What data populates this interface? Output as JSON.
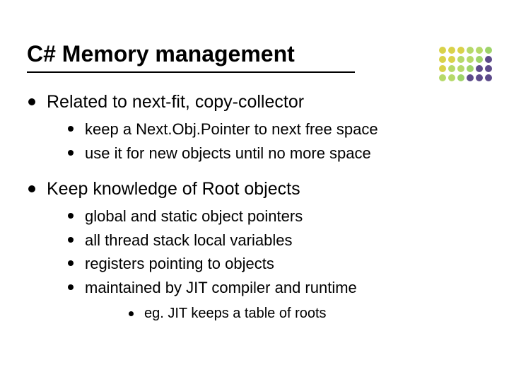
{
  "title": "C# Memory management",
  "bullets": {
    "item1": {
      "text": "Related to next-fit, copy-collector",
      "sub1": "keep a Next.Obj.Pointer to next free space",
      "sub2": "use it for new objects until no more space"
    },
    "item2": {
      "text": "Keep knowledge of Root objects",
      "sub1": "global and static object pointers",
      "sub2": "all thread stack local variables",
      "sub3": "registers pointing to objects",
      "sub4": "maintained by JIT compiler and runtime",
      "sub4a": "eg. JIT keeps a table of roots"
    }
  },
  "decor_colors": [
    "#d9d24a",
    "#d9d24a",
    "#d9d24a",
    "#b6d96a",
    "#b6d96a",
    "#9ed36a",
    "#d9d24a",
    "#d9d24a",
    "#b6d96a",
    "#b6d96a",
    "#9ed36a",
    "#5c4a8a",
    "#d9d24a",
    "#b6d96a",
    "#b6d96a",
    "#9ed36a",
    "#5c4a8a",
    "#5c4a8a",
    "#b6d96a",
    "#b6d96a",
    "#9ed36a",
    "#5c4a8a",
    "#5c4a8a",
    "#5c4a8a"
  ]
}
